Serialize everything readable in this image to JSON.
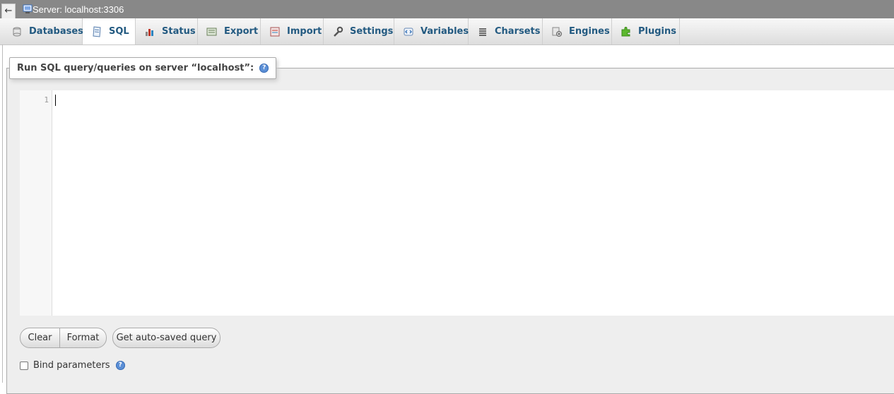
{
  "topbar": {
    "back_glyph": "←",
    "server_label": "Server: localhost:3306",
    "server_icon": "server-icon"
  },
  "tabs": [
    {
      "label": "Databases",
      "icon": "database-icon",
      "active": false
    },
    {
      "label": "SQL",
      "icon": "sql-icon",
      "active": true
    },
    {
      "label": "Status",
      "icon": "status-icon",
      "active": false
    },
    {
      "label": "Export",
      "icon": "export-icon",
      "active": false
    },
    {
      "label": "Import",
      "icon": "import-icon",
      "active": false
    },
    {
      "label": "Settings",
      "icon": "wrench-icon",
      "active": false
    },
    {
      "label": "Variables",
      "icon": "variables-icon",
      "active": false
    },
    {
      "label": "Charsets",
      "icon": "charsets-icon",
      "active": false
    },
    {
      "label": "Engines",
      "icon": "engines-icon",
      "active": false
    },
    {
      "label": "Plugins",
      "icon": "plugins-icon",
      "active": false
    }
  ],
  "query_panel": {
    "legend": "Run SQL query/queries on server “localhost”:",
    "help_glyph": "?"
  },
  "editor": {
    "line_number": "1",
    "content": ""
  },
  "buttons": {
    "clear": "Clear",
    "format": "Format",
    "auto_saved": "Get auto-saved query"
  },
  "bind_parameters": {
    "label": "Bind parameters",
    "checked": false,
    "help_glyph": "?"
  },
  "colors": {
    "tab_text": "#235a81",
    "topbar_bg": "#888888",
    "panel_bg": "#eeeeee"
  }
}
